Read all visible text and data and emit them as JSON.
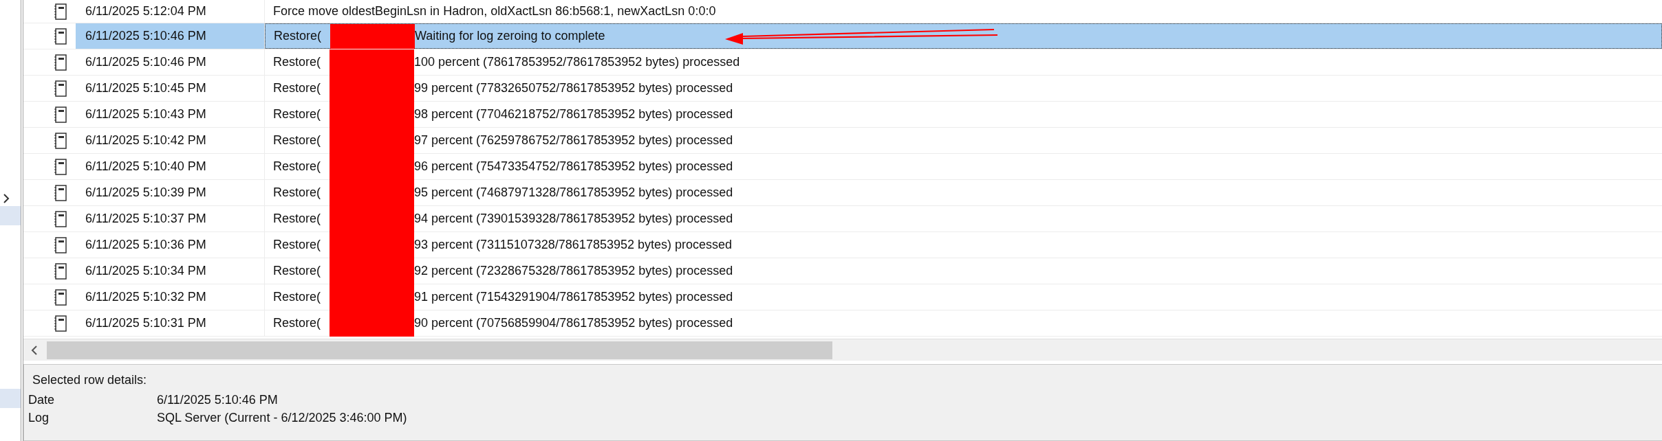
{
  "log_rows": [
    {
      "date": "6/11/2025 5:12:04 PM",
      "kind": "plain",
      "message": "Force move oldestBeginLsn in Hadron, oldXactLsn 86:b568:1, newXactLsn 0:0:0",
      "selected": false
    },
    {
      "date": "6/11/2025 5:10:46 PM",
      "kind": "split",
      "message_start": "Restore(",
      "message_end": "Waiting for log zeroing to complete",
      "selected": true
    },
    {
      "date": "6/11/2025 5:10:46 PM",
      "kind": "split",
      "message_start": "Restore(",
      "message_end": "100 percent (78617853952/78617853952 bytes) processed",
      "selected": false
    },
    {
      "date": "6/11/2025 5:10:45 PM",
      "kind": "split",
      "message_start": "Restore(",
      "message_end": "99 percent (77832650752/78617853952 bytes) processed",
      "selected": false
    },
    {
      "date": "6/11/2025 5:10:43 PM",
      "kind": "split",
      "message_start": "Restore(",
      "message_end": "98 percent (77046218752/78617853952 bytes) processed",
      "selected": false
    },
    {
      "date": "6/11/2025 5:10:42 PM",
      "kind": "split",
      "message_start": "Restore(",
      "message_end": "97 percent (76259786752/78617853952 bytes) processed",
      "selected": false
    },
    {
      "date": "6/11/2025 5:10:40 PM",
      "kind": "split",
      "message_start": "Restore(",
      "message_end": "96 percent (75473354752/78617853952 bytes) processed",
      "selected": false
    },
    {
      "date": "6/11/2025 5:10:39 PM",
      "kind": "split",
      "message_start": "Restore(",
      "message_end": "95 percent (74687971328/78617853952 bytes) processed",
      "selected": false
    },
    {
      "date": "6/11/2025 5:10:37 PM",
      "kind": "split",
      "message_start": "Restore(",
      "message_end": "94 percent (73901539328/78617853952 bytes) processed",
      "selected": false
    },
    {
      "date": "6/11/2025 5:10:36 PM",
      "kind": "split",
      "message_start": "Restore(",
      "message_end": "93 percent (73115107328/78617853952 bytes) processed",
      "selected": false
    },
    {
      "date": "6/11/2025 5:10:34 PM",
      "kind": "split",
      "message_start": "Restore(",
      "message_end": "92 percent (72328675328/78617853952 bytes) processed",
      "selected": false
    },
    {
      "date": "6/11/2025 5:10:32 PM",
      "kind": "split",
      "message_start": "Restore(",
      "message_end": "91 percent (71543291904/78617853952 bytes) processed",
      "selected": false
    },
    {
      "date": "6/11/2025 5:10:31 PM",
      "kind": "split",
      "message_start": "Restore(",
      "message_end": "90 percent (70756859904/78617853952 bytes) processed",
      "selected": false
    }
  ],
  "annotations": {
    "redaction_over_rows": true,
    "arrow_to_selected_row": true
  },
  "details": {
    "heading": "Selected row details:",
    "fields": [
      {
        "label": "Date",
        "value": "6/11/2025 5:10:46 PM"
      },
      {
        "label": "Log",
        "value": "SQL Server (Current - 6/12/2025 3:46:00 PM)"
      }
    ]
  }
}
